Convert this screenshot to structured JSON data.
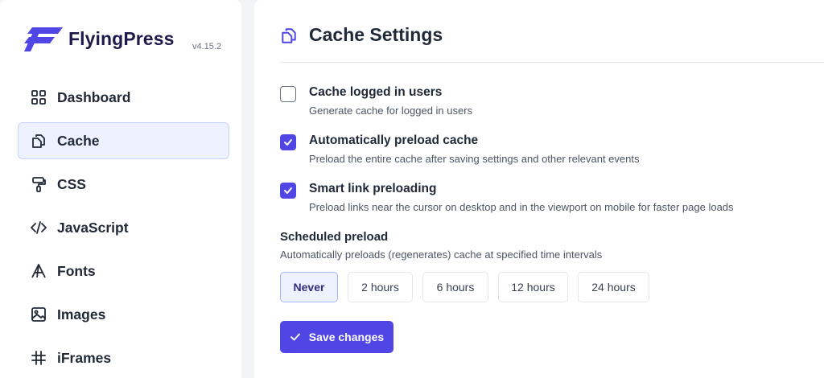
{
  "brand": {
    "name": "FlyingPress",
    "version": "v4.15.2",
    "accent": "#4f46e5"
  },
  "sidebar": {
    "items": [
      {
        "label": "Dashboard",
        "icon": "grid-icon",
        "active": false
      },
      {
        "label": "Cache",
        "icon": "copy-icon",
        "active": true
      },
      {
        "label": "CSS",
        "icon": "paint-roller-icon",
        "active": false
      },
      {
        "label": "JavaScript",
        "icon": "code-icon",
        "active": false
      },
      {
        "label": "Fonts",
        "icon": "font-icon",
        "active": false
      },
      {
        "label": "Images",
        "icon": "image-icon",
        "active": false
      },
      {
        "label": "iFrames",
        "icon": "hash-icon",
        "active": false
      }
    ]
  },
  "page": {
    "title": "Cache Settings",
    "icon": "copy-icon"
  },
  "settings": [
    {
      "label": "Cache logged in users",
      "desc": "Generate cache for logged in users",
      "checked": false
    },
    {
      "label": "Automatically preload cache",
      "desc": "Preload the entire cache after saving settings and other relevant events",
      "checked": true
    },
    {
      "label": "Smart link preloading",
      "desc": "Preload links near the cursor on desktop and in the viewport on mobile for faster page loads",
      "checked": true
    }
  ],
  "schedule": {
    "label": "Scheduled preload",
    "desc": "Automatically preloads (regenerates) cache at specified time intervals",
    "options": [
      "Never",
      "2 hours",
      "6 hours",
      "12 hours",
      "24 hours"
    ],
    "selected": "Never"
  },
  "save_label": "Save changes"
}
